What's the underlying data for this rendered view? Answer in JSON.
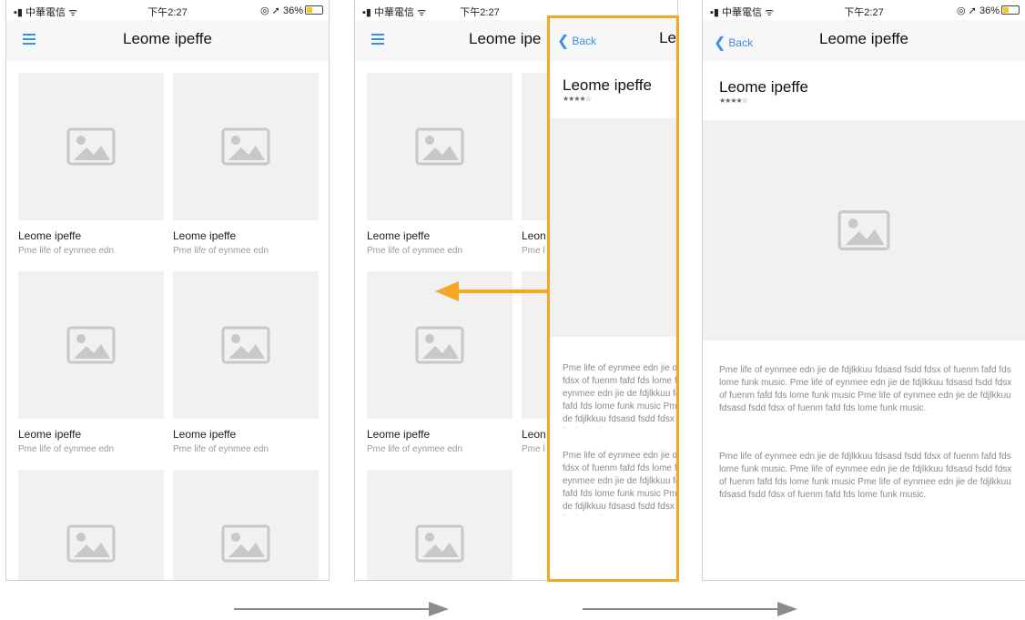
{
  "status": {
    "carrier": "中華電信",
    "time": "下午2:27",
    "battery": "36%"
  },
  "list_screen": {
    "title": "Leome ipeffe",
    "cards": [
      {
        "title": "Leome ipeffe",
        "subtitle": "Pme life of eynmee edn"
      },
      {
        "title": "Leome ipeffe",
        "subtitle": "Pme life of eynmee edn"
      },
      {
        "title": "Leome ipeffe",
        "subtitle": "Pme life of eynmee edn"
      },
      {
        "title": "Leome ipeffe",
        "subtitle": "Pme life of eynmee edn"
      },
      {
        "title": "",
        "subtitle": ""
      },
      {
        "title": "",
        "subtitle": ""
      }
    ]
  },
  "detail_screen": {
    "back_label": "Back",
    "title": "Leome ipeffe",
    "heading": "Leome ipeffe",
    "rating": 4,
    "rating_text": "★★★★☆",
    "paragraph1": "Pme life of eynmee edn jie de fdjlkkuu fdsasd fsdd fdsx of fuenm fafd fds lome funk music. Pme life of eynmee edn jie de fdjlkkuu fdsasd fsdd fdsx of fuenm fafd fds lome funk music  Pme life of eynmee edn jie de fdjlkkuu fdsasd fsdd fdsx of fuenm fafd fds lome funk music.",
    "paragraph2": "Pme life of eynmee edn jie de fdjlkkuu fdsasd fsdd fdsx of fuenm fafd fds lome funk music. Pme life of eynmee edn jie de fdjlkkuu fdsasd fsdd fdsx of fuenm fafd fds lome funk music  Pme life of eynmee edn jie de fdjlkkuu fdsasd fsdd fdsx of fuenm fafd fds lome funk music."
  },
  "transition_screen": {
    "back_label": "Back",
    "title_partial": "Le",
    "heading": "Leome ipeffe",
    "bg_title_partial": "Leome ipe",
    "partial_card_title": "Leon",
    "partial_card_sub": "Pme l"
  },
  "colors": {
    "accent": "#3a8ee6",
    "highlight": "#f5a623",
    "arrow": "#8c8c8c"
  }
}
